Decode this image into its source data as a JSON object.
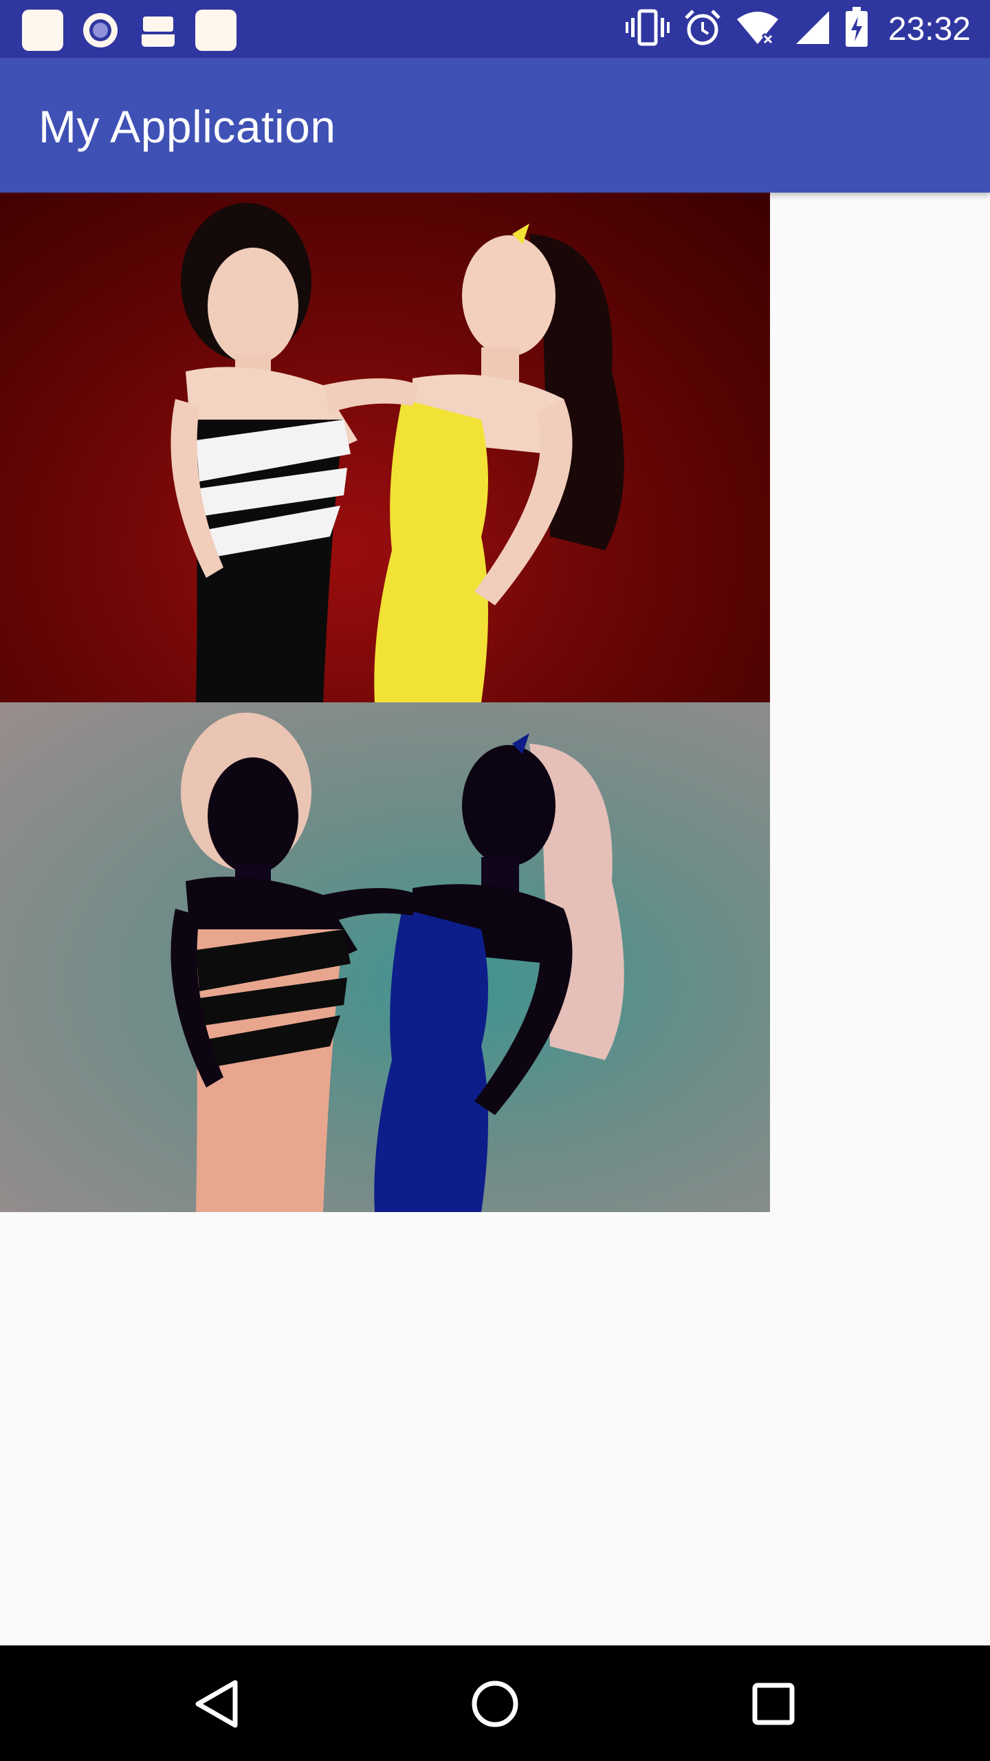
{
  "status_bar": {
    "time": "23:32",
    "background": "#3036a0",
    "left_icons": [
      "notification-app-icon",
      "notification-target-icon",
      "notification-android-icon",
      "notification-app-icon-2"
    ],
    "right_icons": [
      "vibrate-icon",
      "alarm-icon",
      "wifi-icon",
      "cell-signal-icon",
      "battery-charging-icon"
    ]
  },
  "app_bar": {
    "title": "My Application",
    "background": "#3f51b5"
  },
  "images": {
    "original": {
      "background": "#6a0606"
    },
    "inverted": {
      "background": "#6f8c88"
    }
  },
  "nav_bar": {
    "buttons": [
      "back-icon",
      "home-icon",
      "recents-icon"
    ],
    "background": "#000000"
  }
}
